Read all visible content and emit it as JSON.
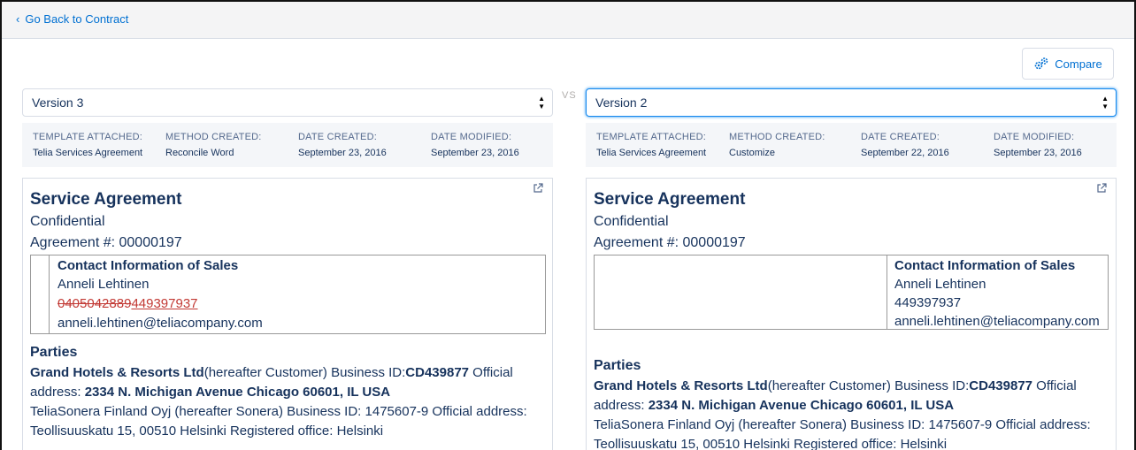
{
  "nav": {
    "back_label": "Go Back to Contract"
  },
  "toolbar": {
    "compare_label": "Compare"
  },
  "vs_label": "VS",
  "left": {
    "version": "Version 3",
    "meta": {
      "template_label": "TEMPLATE ATTACHED:",
      "template_value": "Telia Services Agreement",
      "method_label": "METHOD CREATED:",
      "method_value": "Reconcile Word",
      "created_label": "DATE CREATED:",
      "created_value": "September 23, 2016",
      "modified_label": "DATE MODIFIED:",
      "modified_value": "September 23, 2016"
    },
    "doc": {
      "title": "Service Agreement",
      "confidential": "Confidential",
      "agreement": "Agreement #: 00000197",
      "contact_header": "Contact Information of Sales",
      "contact_name": "Anneli Lehtinen",
      "phone_deleted": "0405042889",
      "phone_inserted": "449397937",
      "email": "anneli.lehtinen@teliacompany.com",
      "parties_heading": "Parties",
      "p1_name": "Grand Hotels & Resorts Ltd",
      "p1_mid": "(hereafter Customer) Business ID:",
      "p1_id": "CD439877",
      "p1_official": " Official",
      "p2_label": "address: ",
      "p2_addr": "2334 N. Michigan Avenue Chicago 60601, IL USA",
      "p3": "TeliaSonera Finland Oyj (hereafter Sonera) Business ID: 1475607-9 Official address:",
      "p4": "Teollisuuskatu 15, 00510 Helsinki Registered office: Helsinki"
    }
  },
  "right": {
    "version": "Version 2",
    "meta": {
      "template_label": "TEMPLATE ATTACHED:",
      "template_value": "Telia Services Agreement",
      "method_label": "METHOD CREATED:",
      "method_value": "Customize",
      "created_label": "DATE CREATED:",
      "created_value": "September 22, 2016",
      "modified_label": "DATE MODIFIED:",
      "modified_value": "September 23, 2016"
    },
    "doc": {
      "title": "Service Agreement",
      "confidential": "Confidential",
      "agreement": "Agreement #: 00000197",
      "contact_header": "Contact Information of Sales",
      "contact_name": "Anneli Lehtinen",
      "phone": "449397937",
      "email": "anneli.lehtinen@teliacompany.com",
      "parties_heading": "Parties",
      "p1_name": "Grand Hotels & Resorts Ltd",
      "p1_mid": "(hereafter Customer) Business ID:",
      "p1_id": "CD439877",
      "p1_official": " Official",
      "p2_label": "address: ",
      "p2_addr": "2334 N. Michigan Avenue Chicago 60601, IL USA",
      "p3": "TeliaSonera Finland Oyj (hereafter Sonera) Business ID: 1475607-9 Official address:",
      "p4": "Teollisuuskatu 15, 00510 Helsinki Registered office: Helsinki"
    }
  }
}
